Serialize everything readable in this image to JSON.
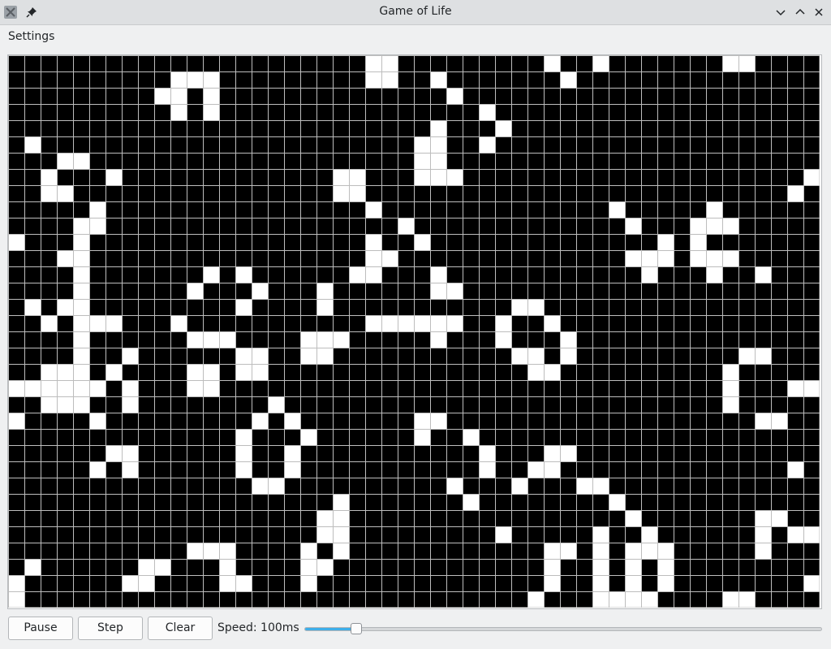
{
  "window": {
    "title": "Game of Life"
  },
  "menu": {
    "settings": "Settings"
  },
  "controls": {
    "pause_label": "Pause",
    "step_label": "Step",
    "clear_label": "Clear",
    "speed_label": "Speed: 100ms",
    "speed_fraction": 0.1
  },
  "board": {
    "cols": 50,
    "rows": 34,
    "dead_color": "#000000",
    "alive_color": "#ffffff",
    "grid_color": "#bdbdbd",
    "live_cells": [
      [
        0,
        22
      ],
      [
        0,
        23
      ],
      [
        0,
        33
      ],
      [
        0,
        36
      ],
      [
        0,
        44
      ],
      [
        0,
        45
      ],
      [
        1,
        10
      ],
      [
        1,
        11
      ],
      [
        1,
        12
      ],
      [
        1,
        22
      ],
      [
        1,
        23
      ],
      [
        1,
        26
      ],
      [
        1,
        34
      ],
      [
        2,
        9
      ],
      [
        2,
        10
      ],
      [
        2,
        12
      ],
      [
        2,
        27
      ],
      [
        3,
        10
      ],
      [
        3,
        12
      ],
      [
        3,
        29
      ],
      [
        4,
        26
      ],
      [
        4,
        30
      ],
      [
        5,
        1
      ],
      [
        5,
        25
      ],
      [
        5,
        26
      ],
      [
        5,
        29
      ],
      [
        6,
        3
      ],
      [
        6,
        4
      ],
      [
        6,
        25
      ],
      [
        6,
        26
      ],
      [
        7,
        2
      ],
      [
        7,
        6
      ],
      [
        7,
        20
      ],
      [
        7,
        21
      ],
      [
        7,
        25
      ],
      [
        7,
        26
      ],
      [
        7,
        27
      ],
      [
        7,
        49
      ],
      [
        8,
        2
      ],
      [
        8,
        3
      ],
      [
        8,
        20
      ],
      [
        8,
        21
      ],
      [
        8,
        48
      ],
      [
        9,
        5
      ],
      [
        9,
        22
      ],
      [
        9,
        37
      ],
      [
        9,
        43
      ],
      [
        10,
        4
      ],
      [
        10,
        5
      ],
      [
        10,
        24
      ],
      [
        10,
        38
      ],
      [
        10,
        42
      ],
      [
        10,
        43
      ],
      [
        10,
        44
      ],
      [
        11,
        0
      ],
      [
        11,
        4
      ],
      [
        11,
        22
      ],
      [
        11,
        25
      ],
      [
        11,
        40
      ],
      [
        11,
        42
      ],
      [
        12,
        3
      ],
      [
        12,
        4
      ],
      [
        12,
        22
      ],
      [
        12,
        23
      ],
      [
        12,
        38
      ],
      [
        12,
        39
      ],
      [
        12,
        40
      ],
      [
        12,
        42
      ],
      [
        12,
        43
      ],
      [
        12,
        44
      ],
      [
        13,
        4
      ],
      [
        13,
        12
      ],
      [
        13,
        14
      ],
      [
        13,
        21
      ],
      [
        13,
        22
      ],
      [
        13,
        26
      ],
      [
        13,
        39
      ],
      [
        13,
        43
      ],
      [
        13,
        46
      ],
      [
        14,
        4
      ],
      [
        14,
        11
      ],
      [
        14,
        15
      ],
      [
        14,
        19
      ],
      [
        14,
        26
      ],
      [
        14,
        27
      ],
      [
        15,
        1
      ],
      [
        15,
        3
      ],
      [
        15,
        4
      ],
      [
        15,
        14
      ],
      [
        15,
        19
      ],
      [
        15,
        31
      ],
      [
        15,
        32
      ],
      [
        16,
        2
      ],
      [
        16,
        4
      ],
      [
        16,
        5
      ],
      [
        16,
        6
      ],
      [
        16,
        10
      ],
      [
        16,
        22
      ],
      [
        16,
        23
      ],
      [
        16,
        24
      ],
      [
        16,
        25
      ],
      [
        16,
        26
      ],
      [
        16,
        27
      ],
      [
        16,
        30
      ],
      [
        16,
        33
      ],
      [
        17,
        4
      ],
      [
        17,
        11
      ],
      [
        17,
        12
      ],
      [
        17,
        13
      ],
      [
        17,
        18
      ],
      [
        17,
        19
      ],
      [
        17,
        20
      ],
      [
        17,
        26
      ],
      [
        17,
        30
      ],
      [
        17,
        34
      ],
      [
        18,
        4
      ],
      [
        18,
        7
      ],
      [
        18,
        14
      ],
      [
        18,
        15
      ],
      [
        18,
        18
      ],
      [
        18,
        19
      ],
      [
        18,
        31
      ],
      [
        18,
        32
      ],
      [
        18,
        34
      ],
      [
        18,
        45
      ],
      [
        18,
        46
      ],
      [
        19,
        2
      ],
      [
        19,
        3
      ],
      [
        19,
        4
      ],
      [
        19,
        6
      ],
      [
        19,
        11
      ],
      [
        19,
        12
      ],
      [
        19,
        14
      ],
      [
        19,
        15
      ],
      [
        19,
        32
      ],
      [
        19,
        33
      ],
      [
        19,
        44
      ],
      [
        20,
        0
      ],
      [
        20,
        1
      ],
      [
        20,
        2
      ],
      [
        20,
        3
      ],
      [
        20,
        4
      ],
      [
        20,
        5
      ],
      [
        20,
        7
      ],
      [
        20,
        11
      ],
      [
        20,
        12
      ],
      [
        20,
        44
      ],
      [
        20,
        48
      ],
      [
        20,
        49
      ],
      [
        21,
        2
      ],
      [
        21,
        3
      ],
      [
        21,
        4
      ],
      [
        21,
        7
      ],
      [
        21,
        16
      ],
      [
        21,
        44
      ],
      [
        22,
        0
      ],
      [
        22,
        5
      ],
      [
        22,
        15
      ],
      [
        22,
        17
      ],
      [
        22,
        25
      ],
      [
        22,
        26
      ],
      [
        22,
        46
      ],
      [
        22,
        47
      ],
      [
        23,
        14
      ],
      [
        23,
        18
      ],
      [
        23,
        25
      ],
      [
        23,
        28
      ],
      [
        24,
        6
      ],
      [
        24,
        7
      ],
      [
        24,
        14
      ],
      [
        24,
        17
      ],
      [
        24,
        29
      ],
      [
        24,
        33
      ],
      [
        24,
        34
      ],
      [
        25,
        5
      ],
      [
        25,
        7
      ],
      [
        25,
        14
      ],
      [
        25,
        17
      ],
      [
        25,
        29
      ],
      [
        25,
        32
      ],
      [
        25,
        33
      ],
      [
        25,
        48
      ],
      [
        26,
        15
      ],
      [
        26,
        16
      ],
      [
        26,
        27
      ],
      [
        26,
        31
      ],
      [
        26,
        35
      ],
      [
        26,
        36
      ],
      [
        27,
        20
      ],
      [
        27,
        28
      ],
      [
        27,
        37
      ],
      [
        28,
        19
      ],
      [
        28,
        20
      ],
      [
        28,
        38
      ],
      [
        28,
        46
      ],
      [
        28,
        47
      ],
      [
        29,
        19
      ],
      [
        29,
        20
      ],
      [
        29,
        30
      ],
      [
        29,
        36
      ],
      [
        29,
        39
      ],
      [
        29,
        46
      ],
      [
        29,
        48
      ],
      [
        29,
        49
      ],
      [
        30,
        11
      ],
      [
        30,
        12
      ],
      [
        30,
        13
      ],
      [
        30,
        18
      ],
      [
        30,
        20
      ],
      [
        30,
        33
      ],
      [
        30,
        34
      ],
      [
        30,
        36
      ],
      [
        30,
        38
      ],
      [
        30,
        39
      ],
      [
        30,
        40
      ],
      [
        30,
        46
      ],
      [
        31,
        1
      ],
      [
        31,
        8
      ],
      [
        31,
        9
      ],
      [
        31,
        13
      ],
      [
        31,
        18
      ],
      [
        31,
        19
      ],
      [
        31,
        33
      ],
      [
        31,
        36
      ],
      [
        31,
        38
      ],
      [
        31,
        40
      ],
      [
        32,
        0
      ],
      [
        32,
        7
      ],
      [
        32,
        8
      ],
      [
        32,
        13
      ],
      [
        32,
        14
      ],
      [
        32,
        18
      ],
      [
        32,
        33
      ],
      [
        32,
        36
      ],
      [
        32,
        38
      ],
      [
        32,
        40
      ],
      [
        32,
        49
      ],
      [
        33,
        0
      ],
      [
        33,
        32
      ],
      [
        33,
        36
      ],
      [
        33,
        37
      ],
      [
        33,
        38
      ],
      [
        33,
        39
      ],
      [
        33,
        44
      ],
      [
        33,
        45
      ]
    ]
  }
}
